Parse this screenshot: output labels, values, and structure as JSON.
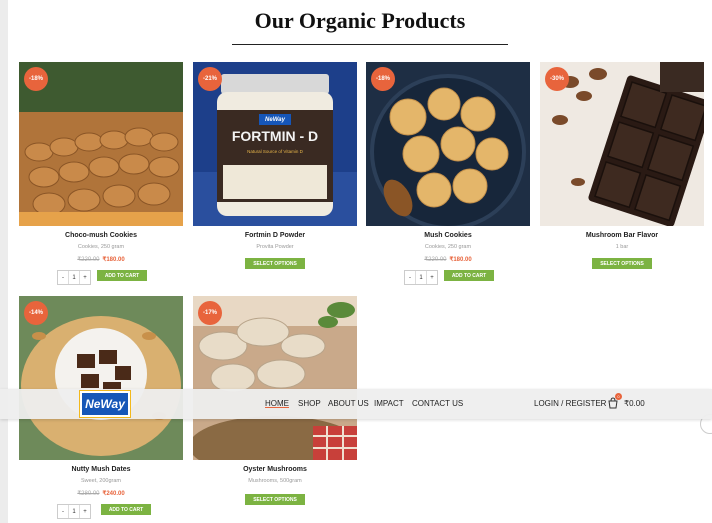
{
  "heading": "Our Organic Products",
  "products": [
    {
      "badge": "-18%",
      "name": "Choco-mush Cookies",
      "meta": "Cookies, 250 gram",
      "old_price": "₹220.00",
      "price": "₹180.00",
      "qty": "1",
      "qty_minus": "-",
      "qty_plus": "+",
      "button": "ADD TO CART"
    },
    {
      "badge": "-21%",
      "name": "Fortmin D Powder",
      "meta": "Provita Powder",
      "button": "SELECT OPTIONS",
      "jar_brand": "NeWay",
      "jar_label": "FORTMIN - D",
      "jar_sub": "Natural Source of Vitamin D"
    },
    {
      "badge": "-18%",
      "name": "Mush Cookies",
      "meta": "Cookies, 250 gram",
      "old_price": "₹220.00",
      "price": "₹180.00",
      "qty": "1",
      "qty_minus": "-",
      "qty_plus": "+",
      "button": "ADD TO CART"
    },
    {
      "badge": "-30%",
      "name": "Mushroom Bar Flavor",
      "meta": "1 bar",
      "button": "SELECT OPTIONS"
    },
    {
      "badge": "-14%",
      "name": "Nutty Mush Dates",
      "meta": "Sweet, 200gram",
      "old_price": "₹280.00",
      "price": "₹240.00",
      "qty": "1",
      "qty_minus": "-",
      "qty_plus": "+",
      "button": "ADD TO CART"
    },
    {
      "badge": "-17%",
      "name": "Oyster Mushrooms",
      "meta": "Mushrooms, 500gram",
      "button": "SELECT OPTIONS"
    }
  ],
  "nav": {
    "logo": "NeWay",
    "items": [
      "HOME",
      "SHOP",
      "ABOUT US",
      "IMPACT",
      "CONTACT US"
    ],
    "login": "LOGIN / REGISTER",
    "cart_count": "0",
    "cart_total": "₹0.00"
  },
  "colors": {
    "accent": "#e8643c",
    "button": "#7cb342",
    "logo_bg": "#1656b8"
  }
}
